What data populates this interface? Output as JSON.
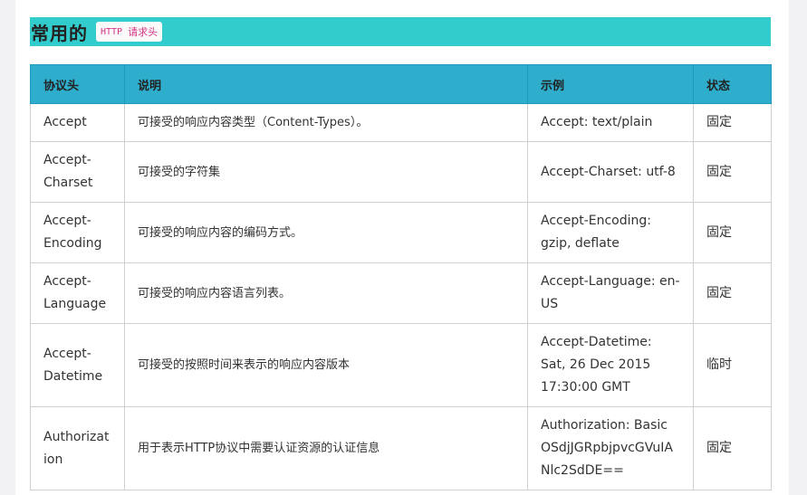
{
  "section": {
    "title": "常用的",
    "tag_code": "HTTP",
    "tag_text": "请求头"
  },
  "table": {
    "headers": [
      "协议头",
      "说明",
      "示例",
      "状态"
    ],
    "rows": [
      [
        "Accept",
        "可接受的响应内容类型（Content-Types）。",
        "Accept: text/plain",
        "固定"
      ],
      [
        "Accept-Charset",
        "可接受的字符集",
        "Accept-Charset: utf-8",
        "固定"
      ],
      [
        "Accept-Encoding",
        "可接受的响应内容的编码方式。",
        "Accept-Encoding: gzip, deflate",
        "固定"
      ],
      [
        "Accept-Language",
        "可接受的响应内容语言列表。",
        "Accept-Language: en-US",
        "固定"
      ],
      [
        "Accept-Datetime",
        "可接受的按照时间来表示的响应内容版本",
        "Accept-Datetime: Sat, 26 Dec 2015 17:30:00 GMT",
        "临时"
      ],
      [
        "Authorization",
        "用于表示HTTP协议中需要认证资源的认证信息",
        "Authorization: Basic OSdjJGRpbjpvcGVuIANlc2SdDE==",
        "固定"
      ]
    ]
  }
}
